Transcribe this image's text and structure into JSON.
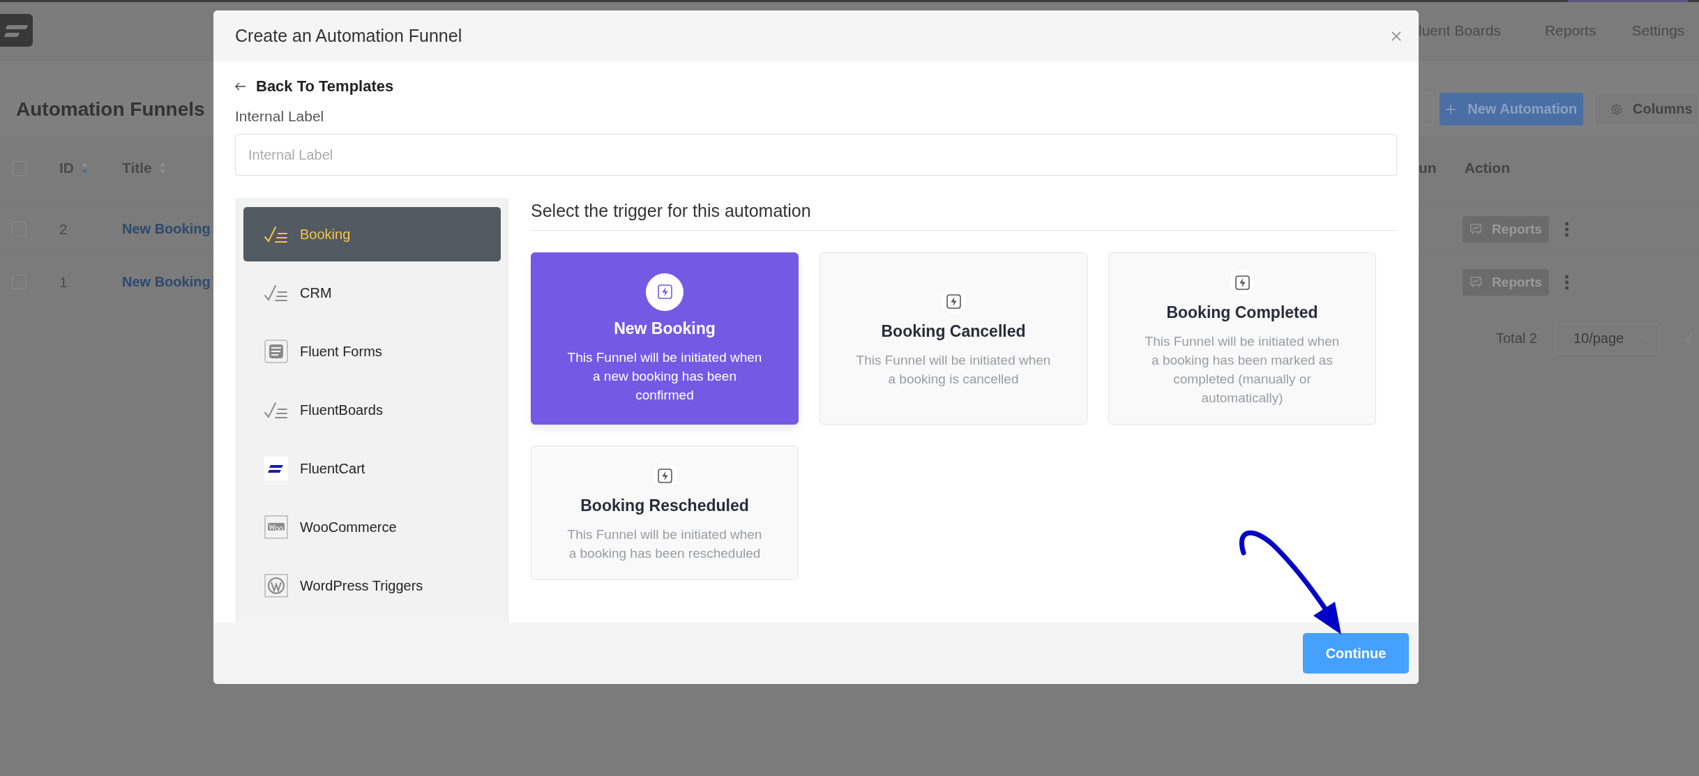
{
  "top_nav": [
    {
      "label": "luent Boards"
    },
    {
      "label": "Reports"
    },
    {
      "label": "Settings"
    }
  ],
  "page_title": "Automation Funnels",
  "toolbar": {
    "new_button": "New Automation",
    "columns_button": "Columns"
  },
  "table": {
    "all_checked": false,
    "columns": [
      {
        "label": "ID"
      },
      {
        "label": "Title"
      }
    ],
    "right_columns": [
      {
        "label": "un"
      },
      {
        "label": "Action"
      }
    ],
    "rows": [
      {
        "checked": false,
        "id": "2",
        "title": "New Booking",
        "action": "Reports"
      },
      {
        "checked": false,
        "id": "1",
        "title": "New Booking",
        "action": "Reports"
      }
    ]
  },
  "pagination": {
    "total": "Total 2",
    "page_size": "10/page"
  },
  "dialog": {
    "title": "Create an Automation Funnel",
    "back_link": "Back To Templates",
    "label_field": {
      "label": "Internal Label",
      "placeholder": "Internal Label"
    },
    "categories": [
      {
        "label": "Booking",
        "kind": "checklist",
        "selected": true
      },
      {
        "label": "CRM",
        "kind": "checklist",
        "selected": false
      },
      {
        "label": "Fluent Forms",
        "kind": "form",
        "selected": false
      },
      {
        "label": "FluentBoards",
        "kind": "checklist",
        "selected": false
      },
      {
        "label": "FluentCart",
        "kind": "cart",
        "selected": false
      },
      {
        "label": "WooCommerce",
        "kind": "woo",
        "selected": false
      },
      {
        "label": "WordPress Triggers",
        "kind": "wordpress",
        "selected": false
      }
    ],
    "trigger_heading": "Select the trigger for this automation",
    "triggers": [
      {
        "title": "New Booking",
        "description": "This Funnel will be initiated when a new booking has been confirmed",
        "selected": true
      },
      {
        "title": "Booking Cancelled",
        "description": "This Funnel will be initiated when a booking is cancelled",
        "selected": false
      },
      {
        "title": "Booking Completed",
        "description": "This Funnel will be initiated when a booking has been marked as completed (manually or automatically)",
        "selected": false
      },
      {
        "title": "Booking Rescheduled",
        "description": "This Funnel will be initiated when a booking has been rescheduled",
        "selected": false
      }
    ],
    "continue_button": "Continue"
  }
}
